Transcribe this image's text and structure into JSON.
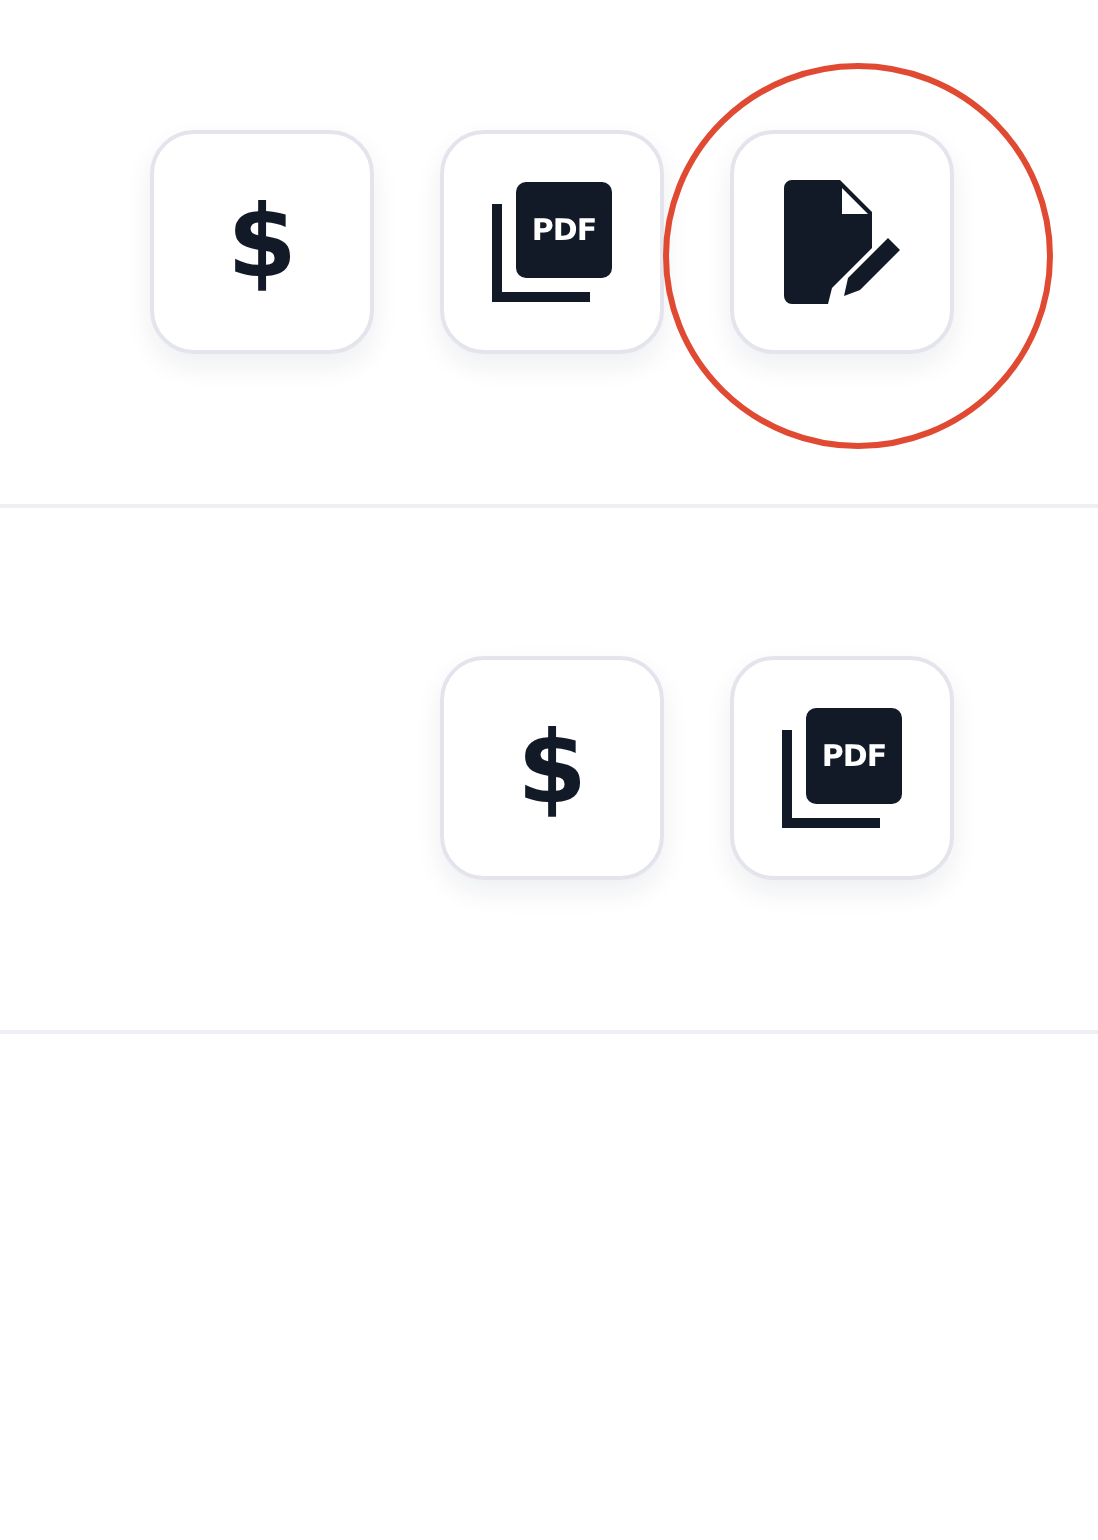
{
  "rows": [
    {
      "actions": [
        {
          "kind": "payment",
          "label": "$",
          "highlighted": false
        },
        {
          "kind": "pdf",
          "label": "PDF",
          "highlighted": false
        },
        {
          "kind": "edit",
          "highlighted": true
        }
      ]
    },
    {
      "actions": [
        {
          "kind": "payment",
          "label": "$",
          "highlighted": false
        },
        {
          "kind": "pdf",
          "label": "PDF",
          "highlighted": false
        }
      ]
    }
  ]
}
